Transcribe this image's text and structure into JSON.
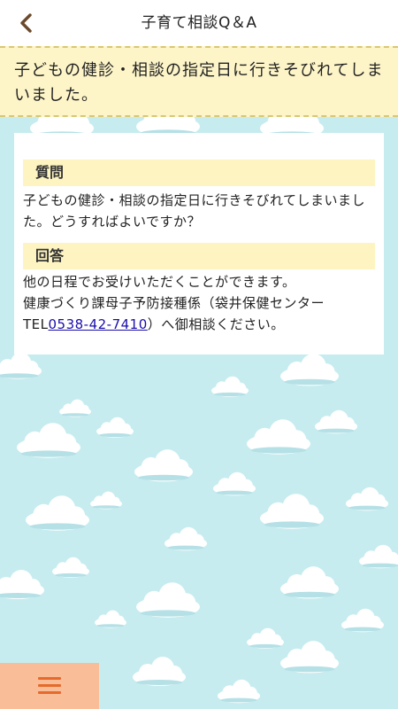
{
  "header": {
    "title": "子育て相談Q＆A",
    "back_icon": "chevron-left-icon"
  },
  "banner": {
    "text": "子どもの健診・相談の指定日に行きそびれてしまいました。"
  },
  "question": {
    "heading": "質問",
    "body": "子どもの健診・相談の指定日に行きそびれてしまいました。どうすればよいですか？"
  },
  "answer": {
    "heading": "回答",
    "line1": "他の日程でお受けいただくことができます。",
    "line2": "健康づくり課母子予防接種係（袋井保健センター",
    "tel_prefix": "TEL",
    "tel_number": "0538-42-7410",
    "tel_suffix": "）へ御相談ください。"
  },
  "footer": {
    "menu_icon": "hamburger-menu-icon"
  },
  "colors": {
    "background": "#c7ecef",
    "banner": "#fdf5c8",
    "section_head": "#fdf4c1",
    "menu_button": "#f9be97",
    "menu_icon": "#e56a2c",
    "link": "#1a0dab"
  }
}
